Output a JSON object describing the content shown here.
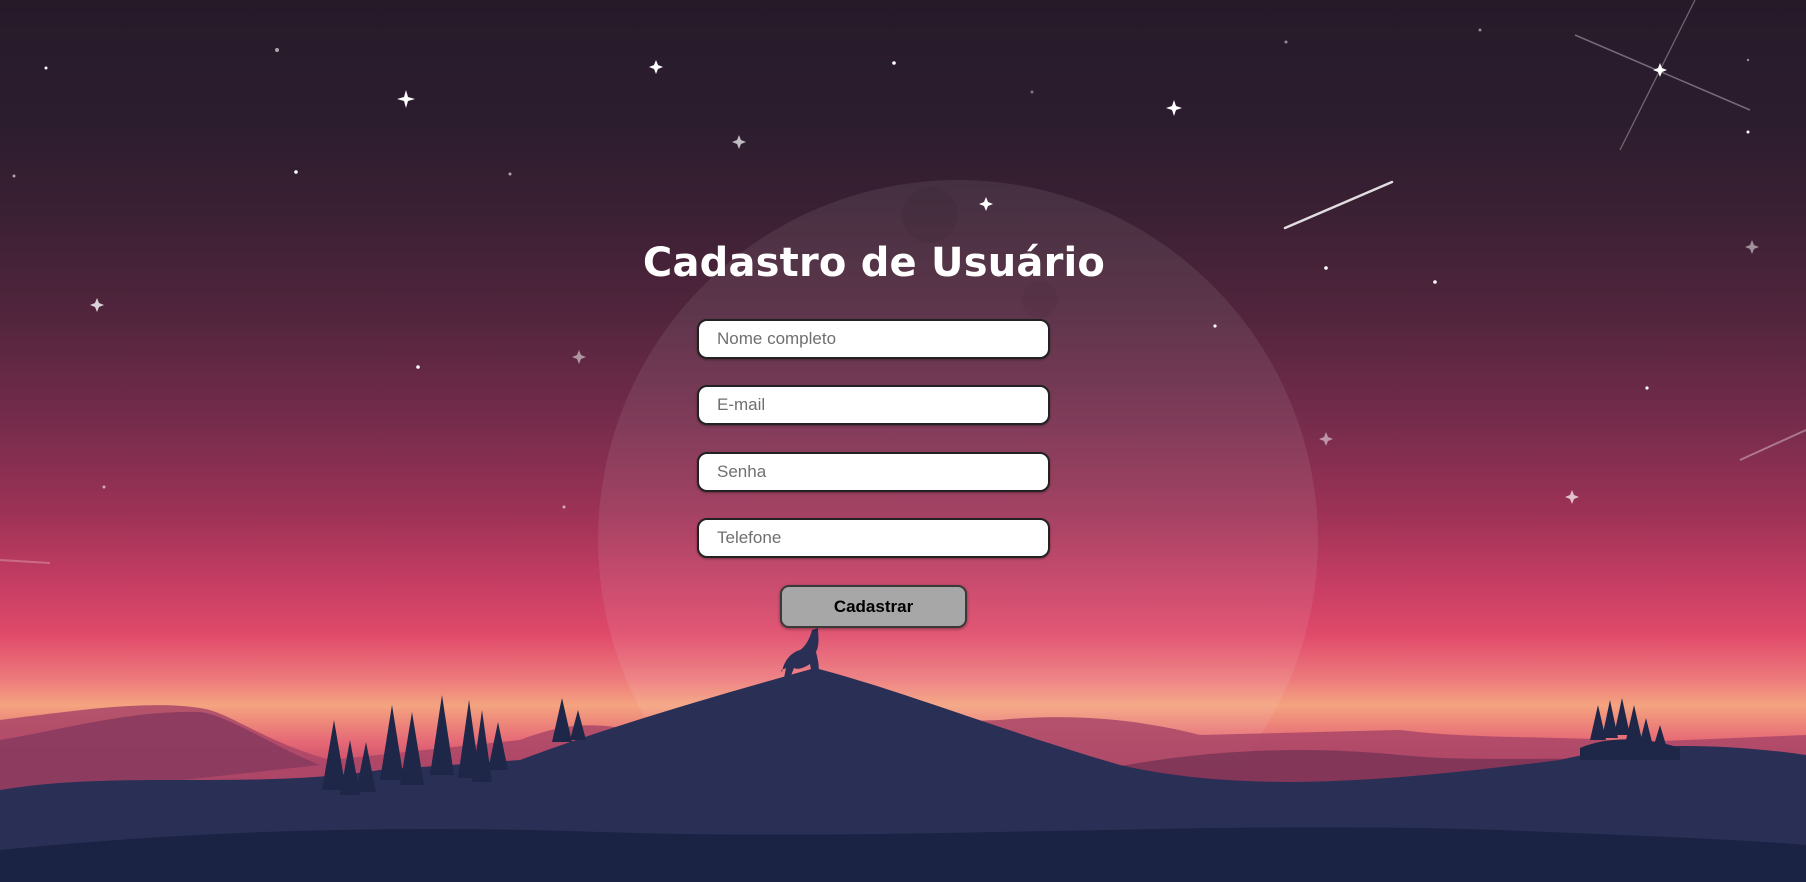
{
  "page": {
    "title": "Cadastro de Usuário"
  },
  "form": {
    "fields": [
      {
        "name": "nome",
        "placeholder": "Nome completo",
        "value": ""
      },
      {
        "name": "email",
        "placeholder": "E-mail",
        "value": ""
      },
      {
        "name": "senha",
        "placeholder": "Senha",
        "value": ""
      },
      {
        "name": "telefone",
        "placeholder": "Telefone",
        "value": ""
      }
    ],
    "submit_label": "Cadastrar"
  },
  "colors": {
    "sky_top": "#261a29",
    "sky_mid": "#9c3256",
    "horizon_glow": "#f4a37f",
    "mountain_front": "#1c2645",
    "button_bg": "#a7a7a7",
    "title_text": "#ffffff"
  },
  "background": {
    "description_icons": [
      "moon-icon",
      "star-icon",
      "shooting-star-icon",
      "wolf-icon",
      "pine-tree-icon",
      "mountain-icon"
    ]
  }
}
